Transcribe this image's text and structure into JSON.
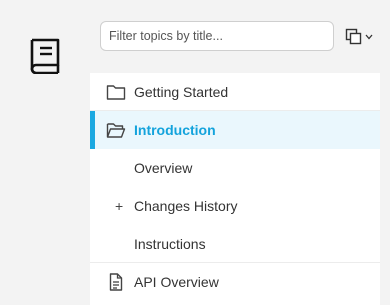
{
  "search": {
    "placeholder": "Filter topics by title..."
  },
  "nav": {
    "items": [
      {
        "label": "Getting Started"
      },
      {
        "label": "Introduction"
      },
      {
        "label": "Overview"
      },
      {
        "label": "Changes History",
        "expander": "+"
      },
      {
        "label": "Instructions"
      },
      {
        "label": "API Overview"
      }
    ]
  },
  "colors": {
    "accent": "#1aa8e1",
    "active_background": "#eaf7fd",
    "rail_background": "#f3f3f3"
  }
}
